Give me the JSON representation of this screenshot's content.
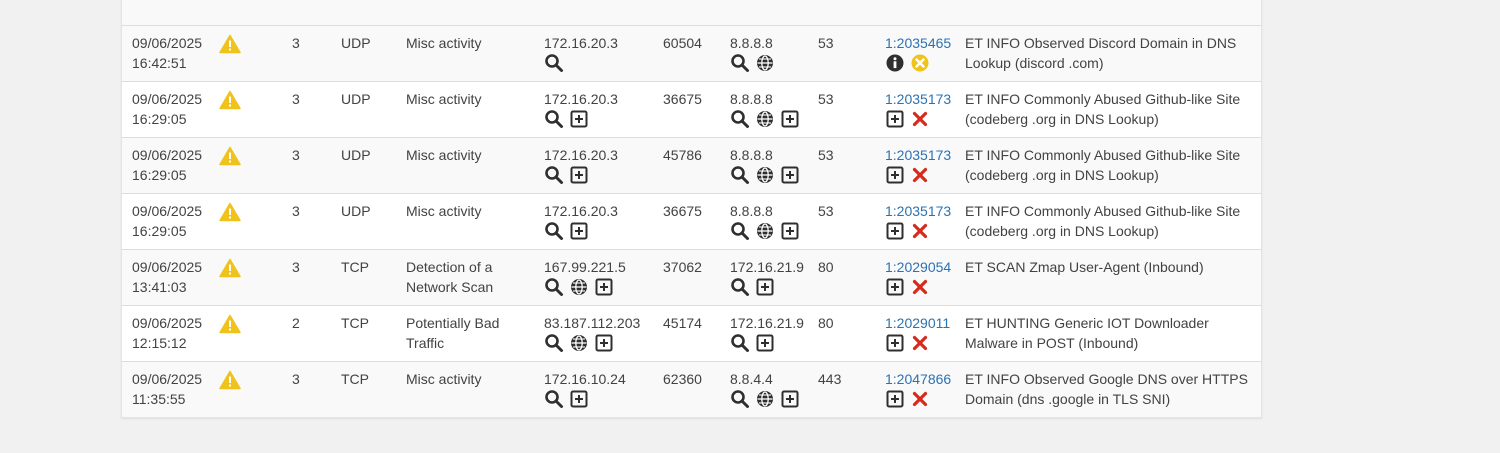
{
  "colors": {
    "link": "#2b72b3",
    "warning": "#f0c21c",
    "danger": "#d9291c",
    "icon": "#333333"
  },
  "rows": [
    {
      "date": "",
      "time": "16:42:51",
      "priority": "",
      "protocol": "",
      "classification": "",
      "src": "",
      "sport": "",
      "dst": "",
      "dport": "",
      "sid": "",
      "description": "",
      "description2": "Lookup (discord .com)",
      "src_icons": [
        "search-icon"
      ],
      "dst_icons": [
        "search-icon"
      ],
      "sid_icons": [
        "info-icon",
        "suppressed-icon"
      ]
    },
    {
      "date": "09/06/2025",
      "time": "16:42:51",
      "priority": "3",
      "protocol": "UDP",
      "classification": "Misc activity",
      "src": "172.16.20.3",
      "sport": "60504",
      "dst": "8.8.8.8",
      "dport": "53",
      "sid": "1:2035465",
      "description": "ET INFO Observed Discord Domain in DNS",
      "description2": "Lookup (discord .com)",
      "src_icons": [
        "search-icon"
      ],
      "dst_icons": [
        "search-icon",
        "globe-icon"
      ],
      "sid_icons": [
        "info-icon",
        "suppressed-icon"
      ]
    },
    {
      "date": "09/06/2025",
      "time": "16:29:05",
      "priority": "3",
      "protocol": "UDP",
      "classification": "Misc activity",
      "src": "172.16.20.3",
      "sport": "36675",
      "dst": "8.8.8.8",
      "dport": "53",
      "sid": "1:2035173",
      "description": "ET INFO Commonly Abused Github-like Site",
      "description2": "(codeberg .org in DNS Lookup)",
      "src_icons": [
        "search-icon",
        "add-icon"
      ],
      "dst_icons": [
        "search-icon",
        "globe-icon",
        "add-icon"
      ],
      "sid_icons": [
        "add-icon",
        "remove-icon"
      ]
    },
    {
      "date": "09/06/2025",
      "time": "16:29:05",
      "priority": "3",
      "protocol": "UDP",
      "classification": "Misc activity",
      "src": "172.16.20.3",
      "sport": "45786",
      "dst": "8.8.8.8",
      "dport": "53",
      "sid": "1:2035173",
      "description": "ET INFO Commonly Abused Github-like Site",
      "description2": "(codeberg .org in DNS Lookup)",
      "src_icons": [
        "search-icon",
        "add-icon"
      ],
      "dst_icons": [
        "search-icon",
        "globe-icon",
        "add-icon"
      ],
      "sid_icons": [
        "add-icon",
        "remove-icon"
      ]
    },
    {
      "date": "09/06/2025",
      "time": "16:29:05",
      "priority": "3",
      "protocol": "UDP",
      "classification": "Misc activity",
      "src": "172.16.20.3",
      "sport": "36675",
      "dst": "8.8.8.8",
      "dport": "53",
      "sid": "1:2035173",
      "description": "ET INFO Commonly Abused Github-like Site",
      "description2": "(codeberg .org in DNS Lookup)",
      "src_icons": [
        "search-icon",
        "add-icon"
      ],
      "dst_icons": [
        "search-icon",
        "globe-icon",
        "add-icon"
      ],
      "sid_icons": [
        "add-icon",
        "remove-icon"
      ]
    },
    {
      "date": "09/06/2025",
      "time": "13:41:03",
      "priority": "3",
      "protocol": "TCP",
      "classification": "Detection of a",
      "classification2": "Network Scan",
      "src": "167.99.221.5",
      "sport": "37062",
      "dst": "172.16.21.9",
      "dport": "80",
      "sid": "1:2029054",
      "description": "ET SCAN Zmap User-Agent (Inbound)",
      "description2": "",
      "src_icons": [
        "search-icon",
        "globe-icon",
        "add-icon"
      ],
      "dst_icons": [
        "search-icon",
        "add-icon"
      ],
      "sid_icons": [
        "add-icon",
        "remove-icon"
      ]
    },
    {
      "date": "09/06/2025",
      "time": "12:15:12",
      "priority": "2",
      "protocol": "TCP",
      "classification": "Potentially Bad",
      "classification2": "Traffic",
      "src": "83.187.112.203",
      "sport": "45174",
      "dst": "172.16.21.9",
      "dport": "80",
      "sid": "1:2029011",
      "description": "ET HUNTING Generic IOT Downloader",
      "description2": "Malware in POST (Inbound)",
      "src_icons": [
        "search-icon",
        "globe-icon",
        "add-icon"
      ],
      "dst_icons": [
        "search-icon",
        "add-icon"
      ],
      "sid_icons": [
        "add-icon",
        "remove-icon"
      ]
    },
    {
      "date": "09/06/2025",
      "time": "11:35:55",
      "priority": "3",
      "protocol": "TCP",
      "classification": "Misc activity",
      "src": "172.16.10.24",
      "sport": "62360",
      "dst": "8.8.4.4",
      "dport": "443",
      "sid": "1:2047866",
      "description": "ET INFO Observed Google DNS over HTTPS",
      "description2": "Domain (dns .google in TLS SNI)",
      "src_icons": [
        "search-icon",
        "add-icon"
      ],
      "dst_icons": [
        "search-icon",
        "globe-icon",
        "add-icon"
      ],
      "sid_icons": [
        "add-icon",
        "remove-icon"
      ]
    }
  ]
}
